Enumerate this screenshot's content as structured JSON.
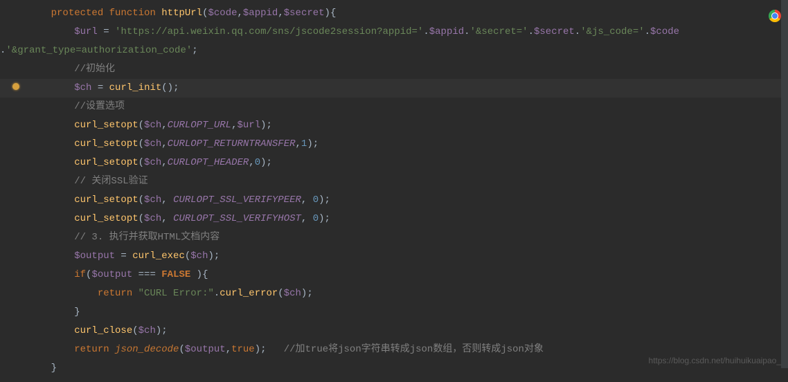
{
  "code": {
    "line1": {
      "kw1": "protected",
      "kw2": "function",
      "fn": "httpUrl",
      "p1": "(",
      "v1": "$code",
      "c1": ",",
      "v2": "$appid",
      "c2": ",",
      "v3": "$secret",
      "p2": "){"
    },
    "line2": {
      "v1": "$url",
      "op": " = ",
      "s1": "'https://api.weixin.qq.com/sns/jscode2session?appid='",
      "d1": ".",
      "v2": "$appid",
      "d2": ".",
      "s2": "'&secret='",
      "d3": ".",
      "v3": "$secret",
      "d4": ".",
      "s3": "'&js_code='",
      "d5": ".",
      "v4": "$code"
    },
    "line3": {
      "pre": ".",
      "s1": "'&grant_type=authorization_code'",
      "end": ";"
    },
    "line4": {
      "c": "//初始化"
    },
    "line5": {
      "v1": "$ch",
      "op": " = ",
      "fn": "curl_init",
      "rest": "();"
    },
    "line6": {
      "c": "//设置选项"
    },
    "line7": {
      "fn": "curl_setopt",
      "p1": "(",
      "v1": "$ch",
      "c1": ",",
      "const": "CURLOPT_URL",
      "c2": ",",
      "v2": "$url",
      "p2": ");"
    },
    "line8": {
      "fn": "curl_setopt",
      "p1": "(",
      "v1": "$ch",
      "c1": ",",
      "const": "CURLOPT_RETURNTRANSFER",
      "c2": ",",
      "n1": "1",
      "p2": ");"
    },
    "line9": {
      "fn": "curl_setopt",
      "p1": "(",
      "v1": "$ch",
      "c1": ",",
      "const": "CURLOPT_HEADER",
      "c2": ",",
      "n1": "0",
      "p2": ");"
    },
    "line10": {
      "c": "// 关闭SSL验证"
    },
    "line11": {
      "fn": "curl_setopt",
      "p1": "(",
      "v1": "$ch",
      "c1": ", ",
      "const": "CURLOPT_SSL_VERIFYPEER",
      "c2": ", ",
      "n1": "0",
      "p2": ");"
    },
    "line12": {
      "fn": "curl_setopt",
      "p1": "(",
      "v1": "$ch",
      "c1": ", ",
      "const": "CURLOPT_SSL_VERIFYHOST",
      "c2": ", ",
      "n1": "0",
      "p2": ");"
    },
    "line13": {
      "c": "// 3. 执行并获取HTML文档内容"
    },
    "line14": {
      "v1": "$output",
      "op": " = ",
      "fn": "curl_exec",
      "p1": "(",
      "v2": "$ch",
      "p2": ");"
    },
    "line15": {
      "kw": "if",
      "p1": "(",
      "v1": "$output",
      "op": " === ",
      "false": "FALSE",
      "p2": " ){"
    },
    "line16": {
      "kw": "return",
      "s1": " \"CURL Error:\"",
      "d1": ".",
      "fn": "curl_error",
      "p1": "(",
      "v1": "$ch",
      "p2": ");"
    },
    "line17": {
      "b": "}"
    },
    "line18": {
      "fn": "curl_close",
      "p1": "(",
      "v1": "$ch",
      "p2": ");"
    },
    "line19": {
      "kw": "return",
      "fn": " json_decode",
      "p1": "(",
      "v1": "$output",
      "c1": ",",
      "true": "true",
      "p2": ");",
      "c": "   //加true将json字符串转成json数组，否则转成json对象"
    },
    "line20": {
      "b": "}"
    }
  },
  "watermark": "https://blog.csdn.net/huihuikuaipao_"
}
